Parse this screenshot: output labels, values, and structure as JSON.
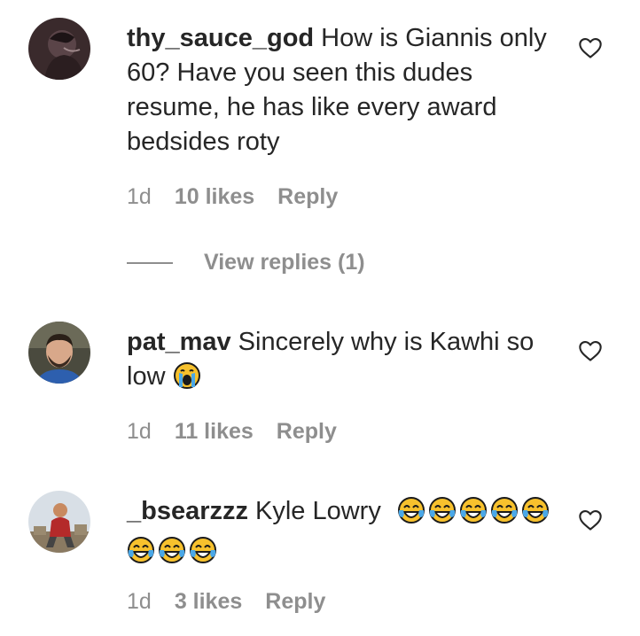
{
  "comments": [
    {
      "username": "thy_sauce_god",
      "text": "How is Giannis only 60? Have you seen this dudes resume, he has like every award bedsides roty",
      "age": "1d",
      "likes": "10 likes",
      "reply": "Reply",
      "view_replies": "View replies (1)",
      "avatar_icon": "user-avatar-dark"
    },
    {
      "username": "pat_mav",
      "text": "Sincerely why is Kawhi so low",
      "emojis": [
        "loudly-crying-face"
      ],
      "age": "1d",
      "likes": "11 likes",
      "reply": "Reply",
      "avatar_icon": "user-avatar-photo"
    },
    {
      "username": "_bsearzzz",
      "text": "Kyle Lowry",
      "emojis": [
        "tears-of-joy",
        "tears-of-joy",
        "tears-of-joy",
        "tears-of-joy",
        "tears-of-joy",
        "tears-of-joy",
        "tears-of-joy",
        "tears-of-joy"
      ],
      "age": "1d",
      "likes": "3 likes",
      "reply": "Reply",
      "avatar_icon": "user-avatar-outdoor"
    }
  ],
  "colors": {
    "text": "#262626",
    "secondary": "#8e8e8e",
    "emoji_yellow": "#f7c12d",
    "emoji_tear": "#4aa8e8"
  }
}
